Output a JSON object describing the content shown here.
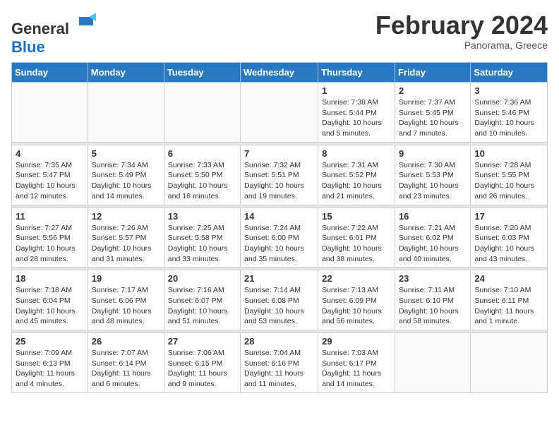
{
  "header": {
    "logo_general": "General",
    "logo_blue": "Blue",
    "month_title": "February 2024",
    "subtitle": "Panorama, Greece"
  },
  "calendar": {
    "days_of_week": [
      "Sunday",
      "Monday",
      "Tuesday",
      "Wednesday",
      "Thursday",
      "Friday",
      "Saturday"
    ],
    "weeks": [
      [
        {
          "day": "",
          "info": ""
        },
        {
          "day": "",
          "info": ""
        },
        {
          "day": "",
          "info": ""
        },
        {
          "day": "",
          "info": ""
        },
        {
          "day": "1",
          "info": "Sunrise: 7:38 AM\nSunset: 5:44 PM\nDaylight: 10 hours\nand 5 minutes."
        },
        {
          "day": "2",
          "info": "Sunrise: 7:37 AM\nSunset: 5:45 PM\nDaylight: 10 hours\nand 7 minutes."
        },
        {
          "day": "3",
          "info": "Sunrise: 7:36 AM\nSunset: 5:46 PM\nDaylight: 10 hours\nand 10 minutes."
        }
      ],
      [
        {
          "day": "4",
          "info": "Sunrise: 7:35 AM\nSunset: 5:47 PM\nDaylight: 10 hours\nand 12 minutes."
        },
        {
          "day": "5",
          "info": "Sunrise: 7:34 AM\nSunset: 5:49 PM\nDaylight: 10 hours\nand 14 minutes."
        },
        {
          "day": "6",
          "info": "Sunrise: 7:33 AM\nSunset: 5:50 PM\nDaylight: 10 hours\nand 16 minutes."
        },
        {
          "day": "7",
          "info": "Sunrise: 7:32 AM\nSunset: 5:51 PM\nDaylight: 10 hours\nand 19 minutes."
        },
        {
          "day": "8",
          "info": "Sunrise: 7:31 AM\nSunset: 5:52 PM\nDaylight: 10 hours\nand 21 minutes."
        },
        {
          "day": "9",
          "info": "Sunrise: 7:30 AM\nSunset: 5:53 PM\nDaylight: 10 hours\nand 23 minutes."
        },
        {
          "day": "10",
          "info": "Sunrise: 7:28 AM\nSunset: 5:55 PM\nDaylight: 10 hours\nand 26 minutes."
        }
      ],
      [
        {
          "day": "11",
          "info": "Sunrise: 7:27 AM\nSunset: 5:56 PM\nDaylight: 10 hours\nand 28 minutes."
        },
        {
          "day": "12",
          "info": "Sunrise: 7:26 AM\nSunset: 5:57 PM\nDaylight: 10 hours\nand 31 minutes."
        },
        {
          "day": "13",
          "info": "Sunrise: 7:25 AM\nSunset: 5:58 PM\nDaylight: 10 hours\nand 33 minutes."
        },
        {
          "day": "14",
          "info": "Sunrise: 7:24 AM\nSunset: 6:00 PM\nDaylight: 10 hours\nand 35 minutes."
        },
        {
          "day": "15",
          "info": "Sunrise: 7:22 AM\nSunset: 6:01 PM\nDaylight: 10 hours\nand 38 minutes."
        },
        {
          "day": "16",
          "info": "Sunrise: 7:21 AM\nSunset: 6:02 PM\nDaylight: 10 hours\nand 40 minutes."
        },
        {
          "day": "17",
          "info": "Sunrise: 7:20 AM\nSunset: 6:03 PM\nDaylight: 10 hours\nand 43 minutes."
        }
      ],
      [
        {
          "day": "18",
          "info": "Sunrise: 7:18 AM\nSunset: 6:04 PM\nDaylight: 10 hours\nand 45 minutes."
        },
        {
          "day": "19",
          "info": "Sunrise: 7:17 AM\nSunset: 6:06 PM\nDaylight: 10 hours\nand 48 minutes."
        },
        {
          "day": "20",
          "info": "Sunrise: 7:16 AM\nSunset: 6:07 PM\nDaylight: 10 hours\nand 51 minutes."
        },
        {
          "day": "21",
          "info": "Sunrise: 7:14 AM\nSunset: 6:08 PM\nDaylight: 10 hours\nand 53 minutes."
        },
        {
          "day": "22",
          "info": "Sunrise: 7:13 AM\nSunset: 6:09 PM\nDaylight: 10 hours\nand 56 minutes."
        },
        {
          "day": "23",
          "info": "Sunrise: 7:11 AM\nSunset: 6:10 PM\nDaylight: 10 hours\nand 58 minutes."
        },
        {
          "day": "24",
          "info": "Sunrise: 7:10 AM\nSunset: 6:11 PM\nDaylight: 11 hours\nand 1 minute."
        }
      ],
      [
        {
          "day": "25",
          "info": "Sunrise: 7:09 AM\nSunset: 6:13 PM\nDaylight: 11 hours\nand 4 minutes."
        },
        {
          "day": "26",
          "info": "Sunrise: 7:07 AM\nSunset: 6:14 PM\nDaylight: 11 hours\nand 6 minutes."
        },
        {
          "day": "27",
          "info": "Sunrise: 7:06 AM\nSunset: 6:15 PM\nDaylight: 11 hours\nand 9 minutes."
        },
        {
          "day": "28",
          "info": "Sunrise: 7:04 AM\nSunset: 6:16 PM\nDaylight: 11 hours\nand 11 minutes."
        },
        {
          "day": "29",
          "info": "Sunrise: 7:03 AM\nSunset: 6:17 PM\nDaylight: 11 hours\nand 14 minutes."
        },
        {
          "day": "",
          "info": ""
        },
        {
          "day": "",
          "info": ""
        }
      ]
    ]
  }
}
